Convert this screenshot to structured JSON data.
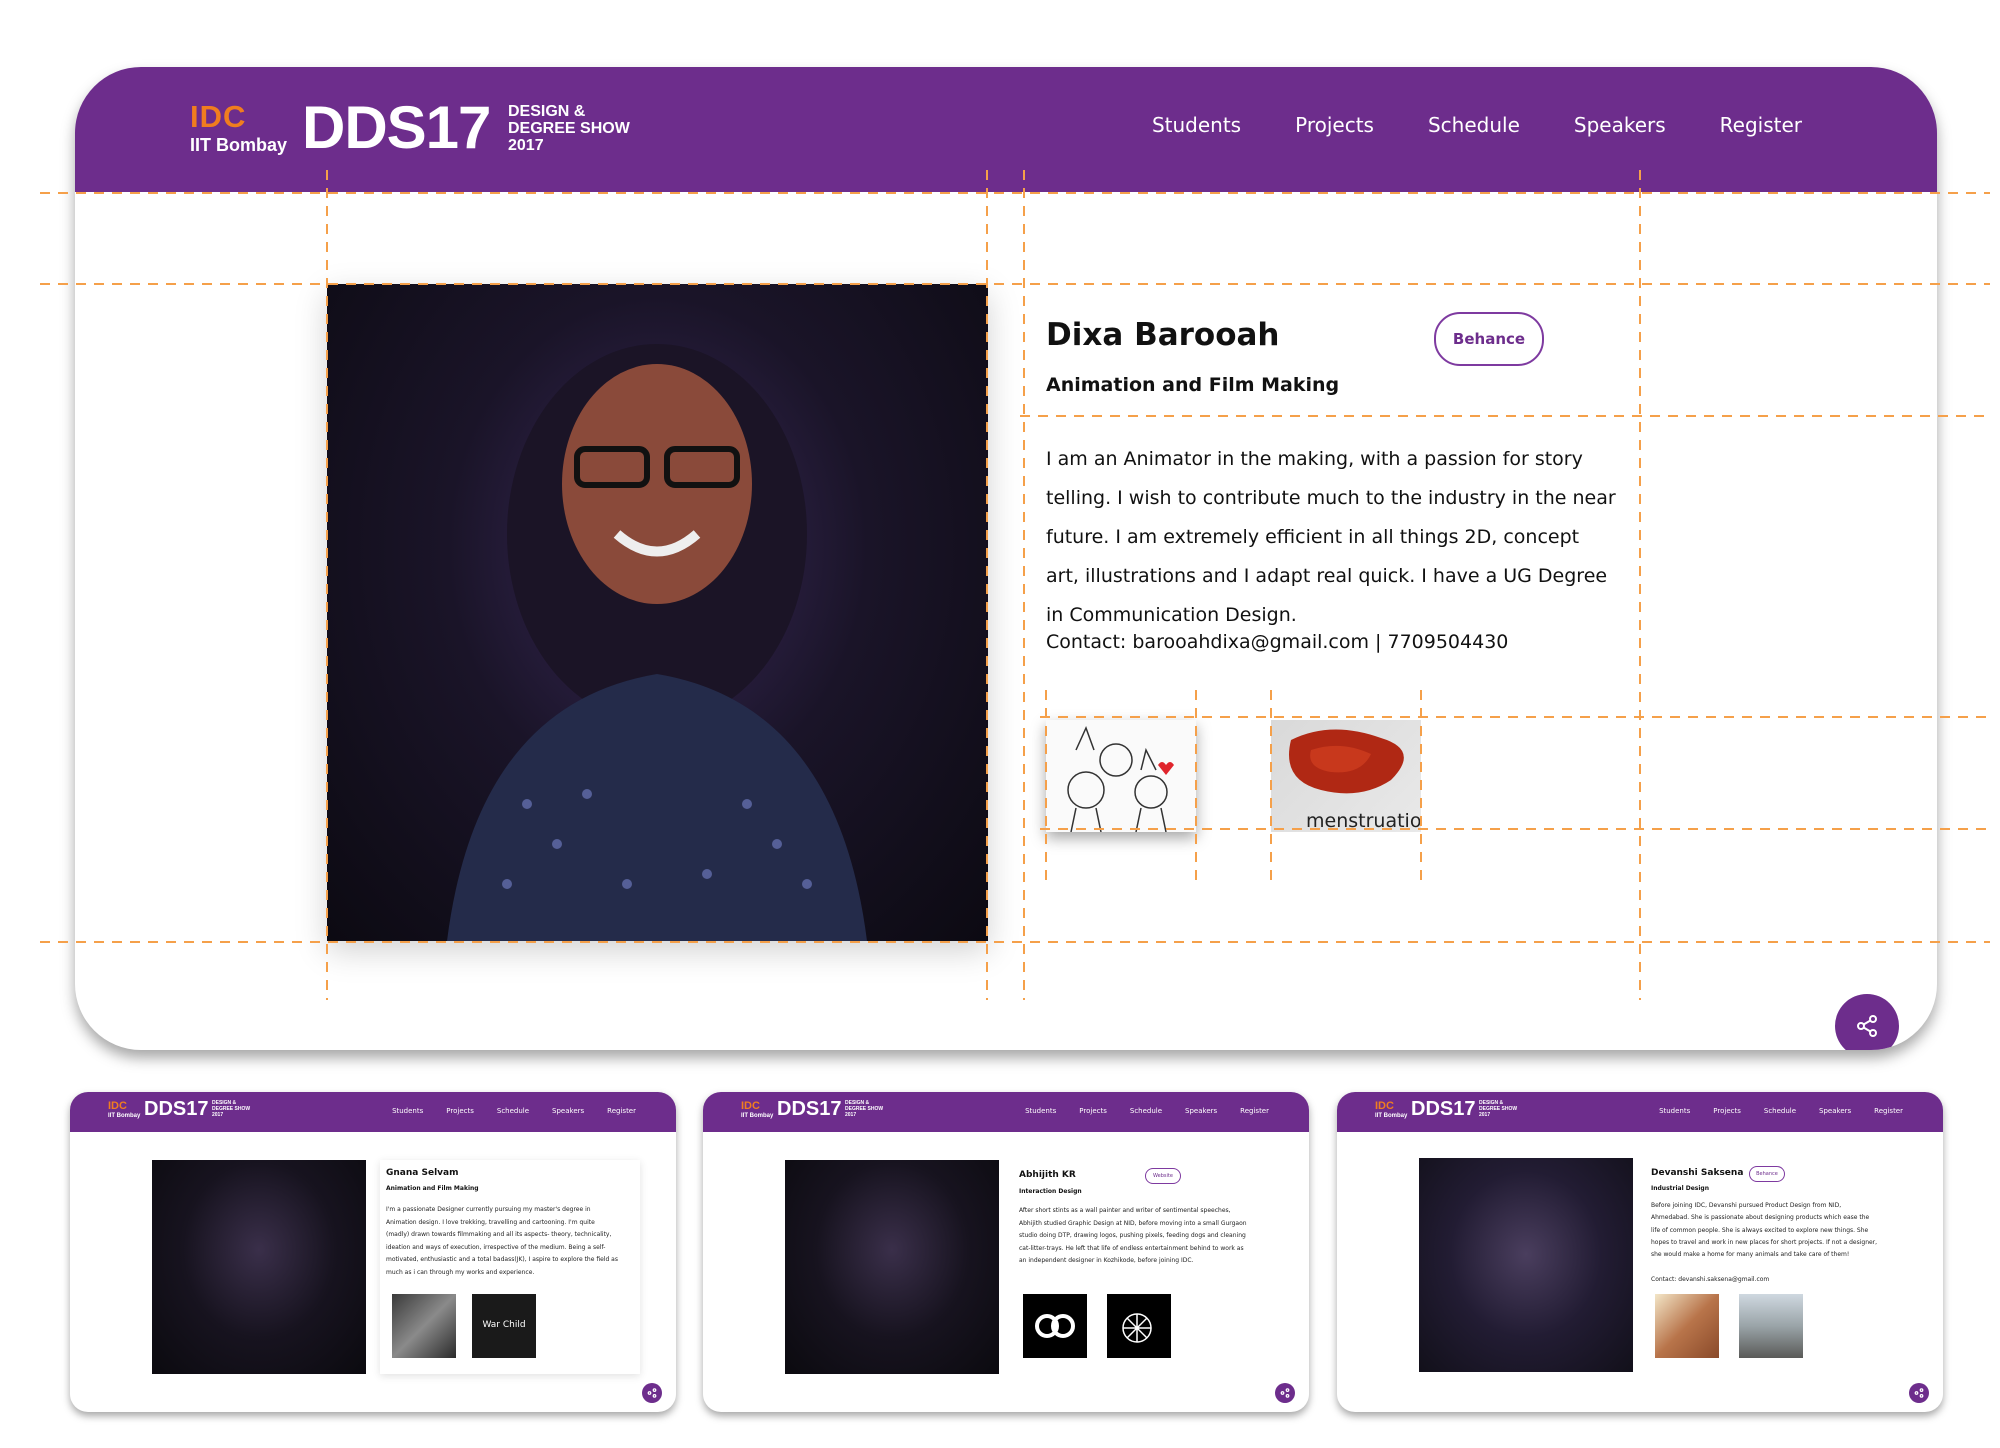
{
  "colors": {
    "brand_purple": "#6d2d8c",
    "brand_orange": "#f07d1f",
    "guide_orange": "#f5a04a"
  },
  "logo": {
    "idc": "IDC",
    "iit": "IIT Bombay",
    "dds": "DDS17",
    "show_line1": "DESIGN &",
    "show_line2": "DEGREE SHOW",
    "show_line3": "2017"
  },
  "nav": {
    "items": [
      "Students",
      "Projects",
      "Schedule",
      "Speakers",
      "Register"
    ]
  },
  "profile": {
    "name": "Dixa Barooah",
    "program": "Animation and Film Making",
    "link_label": "Behance",
    "bio": "I am an Animator in the making, with a passion for story telling. I wish to contribute much to the industry in the near future. I am extremely efficient in all things 2D, concept art, illustrations and I adapt real quick. I have a UG Degree in Communication Design.",
    "contact": "Contact: barooahdixa@gmail.com  |  7709504430",
    "projects": [
      {
        "caption": ""
      },
      {
        "caption": "menstruation"
      }
    ],
    "share_icon": "share-icon"
  },
  "mini_cards": [
    {
      "name": "Gnana Selvam",
      "program": "Animation and Film Making",
      "link_label": "",
      "bio": "I'm a passionate Designer currently pursuing my master's degree in Animation design. I love trekking, travelling and cartooning. I'm quite (madly) drawn towards filmmaking and all its aspects- theory, technicality, ideation and ways of execution, irrespective of the medium. Being a self-motivated, enthusiastic and a total badass(JK), I aspire to explore the field as much as i can through my works and experience.",
      "projects": [
        "",
        "War Child"
      ]
    },
    {
      "name": "Abhijith KR",
      "program": "Interaction Design",
      "link_label": "Website",
      "bio": "After short stints as a wall painter and writer of sentimental speeches, Abhijith studied Graphic Design at NID, before moving into a small Gurgaon studio doing DTP, drawing logos, pushing pixels, feeding dogs and cleaning cat-litter-trays. He left that life of endless entertainment behind to work as an independent designer in Kozhikode, before joining IDC.",
      "projects": [
        "",
        ""
      ]
    },
    {
      "name": "Devanshi Saksena",
      "program": "Industrial Design",
      "link_label": "Behance",
      "bio": "Before joining IDC, Devanshi pursued Product Design from NID, Ahmedabad. She is passionate about designing products which ease the life of common people. She is always excited to explore new things. She hopes to travel and work in new places for short projects. If not a designer, she would make a home for many animals and take care of them!",
      "contact": "Contact: devanshi.saksena@gmail.com",
      "projects": [
        "",
        ""
      ]
    }
  ]
}
